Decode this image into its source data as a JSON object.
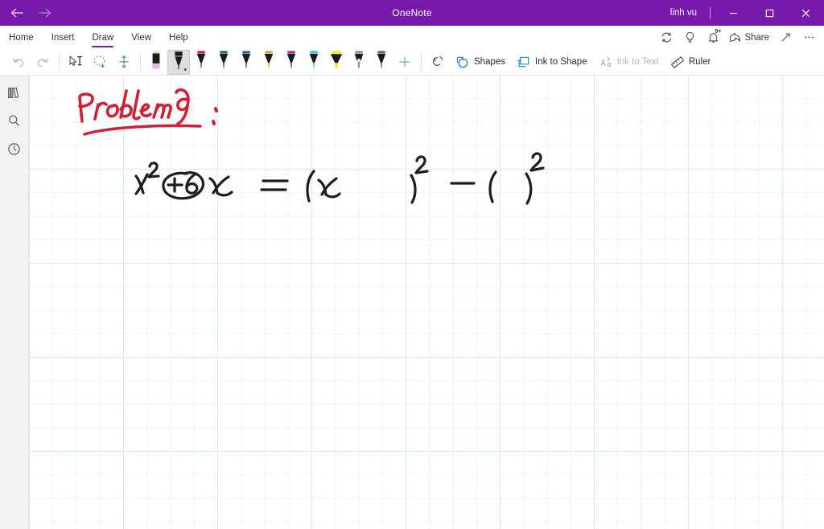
{
  "titlebar": {
    "back_label": "Back",
    "forward_label": "Forward",
    "app_title": "OneNote",
    "account_name": "linh vu",
    "minimize_label": "Minimize",
    "restore_label": "Restore",
    "close_label": "Close",
    "background_color": "#7719aa"
  },
  "ribbon": {
    "tabs": [
      {
        "label": "Home",
        "active": false
      },
      {
        "label": "Insert",
        "active": false
      },
      {
        "label": "Draw",
        "active": true
      },
      {
        "label": "View",
        "active": false
      },
      {
        "label": "Help",
        "active": false
      }
    ],
    "active_tab": "Draw",
    "accent_color": "#7719aa",
    "right_buttons": [
      {
        "name": "sync-icon",
        "label": "Sync"
      },
      {
        "name": "lightbulb-icon",
        "label": "Tell me what you want to do"
      },
      {
        "name": "notifications-icon",
        "label": "Notifications",
        "badge": "9+"
      },
      {
        "name": "share-icon",
        "label": "Share"
      },
      {
        "name": "expand-icon",
        "label": "Full screen"
      },
      {
        "name": "more-options-icon",
        "label": "More options"
      }
    ]
  },
  "toolbar": {
    "undo_label": "Undo",
    "redo_label": "Redo",
    "select_type_label": "Type",
    "lasso_select_label": "Lasso Select",
    "insert_space_label": "Insert Space",
    "add_pen_label": "Add Pen",
    "ink_replay_label": "Ink Replay",
    "pens": [
      {
        "name": "eraser",
        "label": "Eraser",
        "barrel": "#1a1a1a",
        "tip": "#e7b7e0",
        "cap": "#f0dca8",
        "selected": false
      },
      {
        "name": "pen-black-selected",
        "label": "Pen: Black",
        "barrel": "#1a1a1a",
        "tip": "#1a1a1a",
        "cap": "#1a1a1a",
        "selected": true
      },
      {
        "name": "pen-red",
        "label": "Pen: Red",
        "barrel": "#1a1a1a",
        "tip": "#c0202a",
        "cap": "#c0202a",
        "selected": false
      },
      {
        "name": "pen-green",
        "label": "Pen: Green",
        "barrel": "#1a1a1a",
        "tip": "#18733c",
        "cap": "#18733c",
        "selected": false
      },
      {
        "name": "pen-blue",
        "label": "Pen: Blue",
        "barrel": "#1a1a1a",
        "tip": "#1a5a96",
        "cap": "#1a5a96",
        "selected": false
      },
      {
        "name": "pen-gold",
        "label": "Pen: Gold",
        "barrel": "#1a1a1a",
        "tip": "#dba82a",
        "cap": "#dba82a",
        "selected": false
      },
      {
        "name": "pen-magenta",
        "label": "Pen: Magenta",
        "barrel": "#1a1a1a",
        "tip": "#a8229a",
        "cap": "#a8229a",
        "selected": false
      },
      {
        "name": "highlighter-cyan",
        "label": "Highlighter: Cyan",
        "barrel": "#1a1a1a",
        "tip": "#36bde0",
        "cap": "#36bde0",
        "selected": false
      },
      {
        "name": "highlighter-yellow",
        "label": "Highlighter: Yellow",
        "barrel": "#1a1a1a",
        "tip": "#ffe600",
        "cap": "#ffe600",
        "selected": false
      },
      {
        "name": "pencil-grey",
        "label": "Pencil: Grey",
        "barrel": "#1a1a1a",
        "tip": "#8c8c8c",
        "cap": "#8c8c8c",
        "selected": false
      },
      {
        "name": "pen-steel-blue",
        "label": "Pen: Steel Blue",
        "barrel": "#1a1a1a",
        "tip": "#44698f",
        "cap": "#44698f",
        "selected": false
      }
    ],
    "buttons": [
      {
        "name": "shapes-button",
        "label": "Shapes",
        "disabled": false
      },
      {
        "name": "ink-to-shape-button",
        "label": "Ink to Shape",
        "disabled": false
      },
      {
        "name": "ink-to-text-button",
        "label": "Ink to Text",
        "disabled": true
      },
      {
        "name": "ruler-button",
        "label": "Ruler",
        "disabled": false
      }
    ]
  },
  "sidebar": {
    "items": [
      {
        "name": "notebooks-icon",
        "label": "Notebooks"
      },
      {
        "name": "search-icon",
        "label": "Search"
      },
      {
        "name": "recent-notes-icon",
        "label": "Recent Notes"
      }
    ]
  },
  "canvas": {
    "grid_line_color": "#d5ecf2",
    "grid_minor_color": "#eaf6f9",
    "background_color": "#ffffff",
    "ink_notes": [
      {
        "name": "heading-problem-9",
        "text": "Problem 9 :",
        "color": "#d02035",
        "underlined": true
      },
      {
        "name": "equation-line",
        "text": "x² +6 x  =  ( x )² − ( )²",
        "color": "#1a1a1a",
        "annotation": "the term +6 is circled in ink"
      }
    ]
  }
}
